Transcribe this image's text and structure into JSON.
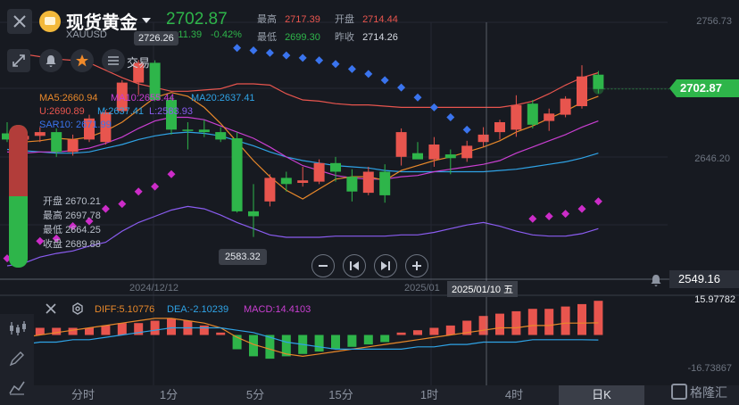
{
  "header": {
    "title": "现货黄金",
    "symbol": "XAUUSD",
    "price": "2702.87",
    "change": "+11.39",
    "change_pct": "-0.42%",
    "stats": {
      "high_label": "最高",
      "high": "2717.39",
      "open_label": "开盘",
      "open": "2714.44",
      "low_label": "最低",
      "low": "2699.30",
      "prev_close_label": "昨收",
      "prev_close": "2714.26"
    }
  },
  "toolbar": {
    "trade_label": "交易"
  },
  "indicators": {
    "ma5": "MA5:2660.94",
    "ma10": "MA10:2655.44",
    "ma20": "MA20:2637.41",
    "boll_u": "U:2690.89",
    "boll_m": "M:2637.41",
    "boll_l": "L:2583.93",
    "sar": "SAR10: 2671.99"
  },
  "ohlc_popup": {
    "open_label": "开盘",
    "open": "2670.21",
    "high_label": "最高",
    "high": "2697.78",
    "low_label": "最低",
    "low": "2664.25",
    "close_label": "收盘",
    "close": "2689.88"
  },
  "price_axis": {
    "top": "2756.73",
    "mid": "2646.20",
    "current": "2702.87",
    "crosshair": "2549.16"
  },
  "callouts": {
    "max": "2726.26",
    "min": "2583.32"
  },
  "date_axis": {
    "left": "2024/12/12",
    "right": "2025/01",
    "crosshair": "2025/01/10 五"
  },
  "macd": {
    "diff": "DIFF:5.10776",
    "dea": "DEA:-2.10239",
    "macd": "MACD:14.4103",
    "axis_top": "15.97782",
    "axis_bottom": "-16.73867"
  },
  "tabs": [
    "分时",
    "1分",
    "5分",
    "15分",
    "1时",
    "4时",
    "日K"
  ],
  "watermark": "格隆汇",
  "colors": {
    "up": "#e8554e",
    "down": "#2eb54a",
    "ma5": "#e8882a",
    "ma10": "#c93fd1",
    "ma20": "#2fa3e6",
    "boll_lower": "#8a5cf0",
    "sar_up": "#3a74ee",
    "sar_down": "#cc2cc8",
    "accent": "#f3b93b",
    "price_tag": "#2eb54a"
  },
  "chart_data": {
    "type": "candlestick",
    "ohlc": [
      {
        "o": 2667,
        "h": 2676,
        "l": 2660,
        "c": 2662
      },
      {
        "o": 2662,
        "h": 2671,
        "l": 2653,
        "c": 2665
      },
      {
        "o": 2665,
        "h": 2672,
        "l": 2660,
        "c": 2668
      },
      {
        "o": 2668,
        "h": 2671,
        "l": 2648,
        "c": 2652
      },
      {
        "o": 2652,
        "h": 2666,
        "l": 2649,
        "c": 2662
      },
      {
        "o": 2662,
        "h": 2682,
        "l": 2660,
        "c": 2679
      },
      {
        "o": 2660,
        "h": 2686,
        "l": 2658,
        "c": 2684
      },
      {
        "o": 2685,
        "h": 2710,
        "l": 2684,
        "c": 2708
      },
      {
        "o": 2708,
        "h": 2726.26,
        "l": 2698,
        "c": 2724
      },
      {
        "o": 2724,
        "h": 2726,
        "l": 2693,
        "c": 2694
      },
      {
        "o": 2694,
        "h": 2697,
        "l": 2666,
        "c": 2670
      },
      {
        "o": 2670,
        "h": 2676,
        "l": 2654,
        "c": 2669
      },
      {
        "o": 2670,
        "h": 2678,
        "l": 2664,
        "c": 2668
      },
      {
        "o": 2668,
        "h": 2672,
        "l": 2660,
        "c": 2662
      },
      {
        "o": 2663,
        "h": 2668,
        "l": 2603,
        "c": 2604
      },
      {
        "o": 2604,
        "h": 2626,
        "l": 2583.32,
        "c": 2600
      },
      {
        "o": 2612,
        "h": 2634,
        "l": 2608,
        "c": 2631
      },
      {
        "o": 2631,
        "h": 2636,
        "l": 2620,
        "c": 2626
      },
      {
        "o": 2627,
        "h": 2640,
        "l": 2624,
        "c": 2629
      },
      {
        "o": 2628,
        "h": 2646,
        "l": 2626,
        "c": 2643
      },
      {
        "o": 2643,
        "h": 2648,
        "l": 2628,
        "c": 2636
      },
      {
        "o": 2632,
        "h": 2638,
        "l": 2612,
        "c": 2620
      },
      {
        "o": 2619,
        "h": 2640,
        "l": 2617,
        "c": 2636
      },
      {
        "o": 2636,
        "h": 2642,
        "l": 2611,
        "c": 2617
      },
      {
        "o": 2648,
        "h": 2671,
        "l": 2641,
        "c": 2668
      },
      {
        "o": 2651,
        "h": 2660,
        "l": 2648,
        "c": 2646
      },
      {
        "o": 2646,
        "h": 2664,
        "l": 2640,
        "c": 2658
      },
      {
        "o": 2650,
        "h": 2654,
        "l": 2634,
        "c": 2647
      },
      {
        "o": 2647,
        "h": 2661,
        "l": 2644,
        "c": 2657
      },
      {
        "o": 2660,
        "h": 2672,
        "l": 2656,
        "c": 2666
      },
      {
        "o": 2668,
        "h": 2678,
        "l": 2662,
        "c": 2676
      },
      {
        "o": 2670,
        "h": 2697.78,
        "l": 2664.25,
        "c": 2689.88
      },
      {
        "o": 2691,
        "h": 2694,
        "l": 2671,
        "c": 2674
      },
      {
        "o": 2677,
        "h": 2687,
        "l": 2669,
        "c": 2683
      },
      {
        "o": 2682,
        "h": 2697,
        "l": 2680,
        "c": 2695
      },
      {
        "o": 2689,
        "h": 2722,
        "l": 2687,
        "c": 2713
      },
      {
        "o": 2714.44,
        "h": 2717.39,
        "l": 2699.3,
        "c": 2702.87
      }
    ],
    "ma5": [
      2663,
      2660,
      2661,
      2663,
      2662,
      2664,
      2669,
      2676,
      2686,
      2696,
      2700,
      2697,
      2688,
      2675,
      2660,
      2645,
      2632,
      2621,
      2614,
      2622,
      2630,
      2632,
      2632,
      2629,
      2637,
      2641,
      2645,
      2648,
      2652,
      2656,
      2661,
      2668,
      2673,
      2679,
      2685,
      2692,
      2697
    ],
    "ma10": [
      2652,
      2651,
      2652,
      2652,
      2653,
      2655,
      2659,
      2664,
      2671,
      2677,
      2680,
      2680,
      2678,
      2673,
      2668,
      2663,
      2656,
      2648,
      2641,
      2637,
      2633,
      2631,
      2630,
      2630,
      2632,
      2633,
      2636,
      2638,
      2640,
      2642,
      2645,
      2651,
      2656,
      2661,
      2666,
      2672,
      2677
    ],
    "ma20": [
      2654,
      2653,
      2652,
      2651,
      2651,
      2652,
      2655,
      2658,
      2662,
      2665,
      2667,
      2668,
      2667,
      2665,
      2661,
      2657,
      2652,
      2648,
      2645,
      2643,
      2641,
      2640,
      2639,
      2637,
      2636,
      2636,
      2636,
      2636,
      2636,
      2636,
      2637,
      2638,
      2640,
      2642,
      2644,
      2647,
      2651
    ],
    "boll_upper": [
      2730,
      2731,
      2729,
      2727,
      2726,
      2724,
      2718,
      2712,
      2707,
      2704,
      2701,
      2701,
      2702,
      2703,
      2707,
      2707,
      2706,
      2699,
      2694,
      2693,
      2691,
      2690,
      2690,
      2689,
      2688,
      2688,
      2688,
      2688,
      2688,
      2688,
      2688,
      2690,
      2693,
      2699,
      2706,
      2712,
      2716
    ],
    "boll_lower": [
      2560,
      2562,
      2567,
      2570,
      2572,
      2576,
      2579,
      2588,
      2595,
      2600,
      2605,
      2608,
      2606,
      2601,
      2595,
      2590,
      2585,
      2583,
      2583,
      2583,
      2584,
      2584,
      2584,
      2584,
      2585,
      2585,
      2587,
      2590,
      2593,
      2595,
      2592,
      2588,
      2585,
      2584,
      2584,
      2586,
      2590
    ],
    "sar": [
      2566,
      2570,
      2580,
      2582,
      2592,
      2596,
      2606,
      2610,
      2620,
      2624,
      2634,
      null,
      null,
      null,
      2736,
      2734,
      2732,
      2730,
      2728,
      2726,
      2723,
      2719,
      2715,
      2710,
      2704,
      2696,
      2688,
      2680,
      2670,
      null,
      null,
      null,
      2598,
      2600,
      2602,
      2606,
      2612
    ],
    "macd_hist": [
      3,
      3,
      3,
      3,
      3,
      3,
      4,
      5,
      5,
      6,
      7,
      6,
      4,
      1,
      -6,
      -9,
      -10,
      -9,
      -8,
      -7,
      -6,
      -5,
      -4,
      -3,
      1,
      2,
      3,
      4,
      6,
      8,
      9,
      10,
      11,
      11,
      12,
      13,
      14.4103
    ],
    "diff": [
      -2,
      -1,
      0,
      1,
      2,
      3,
      4,
      5,
      6,
      7,
      7,
      6,
      5,
      3,
      -1,
      -4,
      -6,
      -8,
      -9,
      -8,
      -7,
      -6,
      -5,
      -4,
      -3,
      -2,
      -1,
      0,
      1,
      2,
      3,
      3,
      4,
      4,
      5,
      5,
      5.10776
    ],
    "dea": [
      -4,
      -4,
      -3,
      -3,
      -2,
      -2,
      -1,
      0,
      1,
      2,
      3,
      3,
      3,
      3,
      2,
      1,
      -1,
      -3,
      -4,
      -5,
      -6,
      -6,
      -6,
      -6,
      -6,
      -5,
      -5,
      -4,
      -4,
      -3,
      -3,
      -3,
      -2,
      -2,
      -2,
      -2,
      -2.10239
    ],
    "ylim": [
      2549.16,
      2756.73
    ],
    "macd_ylim": [
      -16.73867,
      15.97782
    ]
  }
}
